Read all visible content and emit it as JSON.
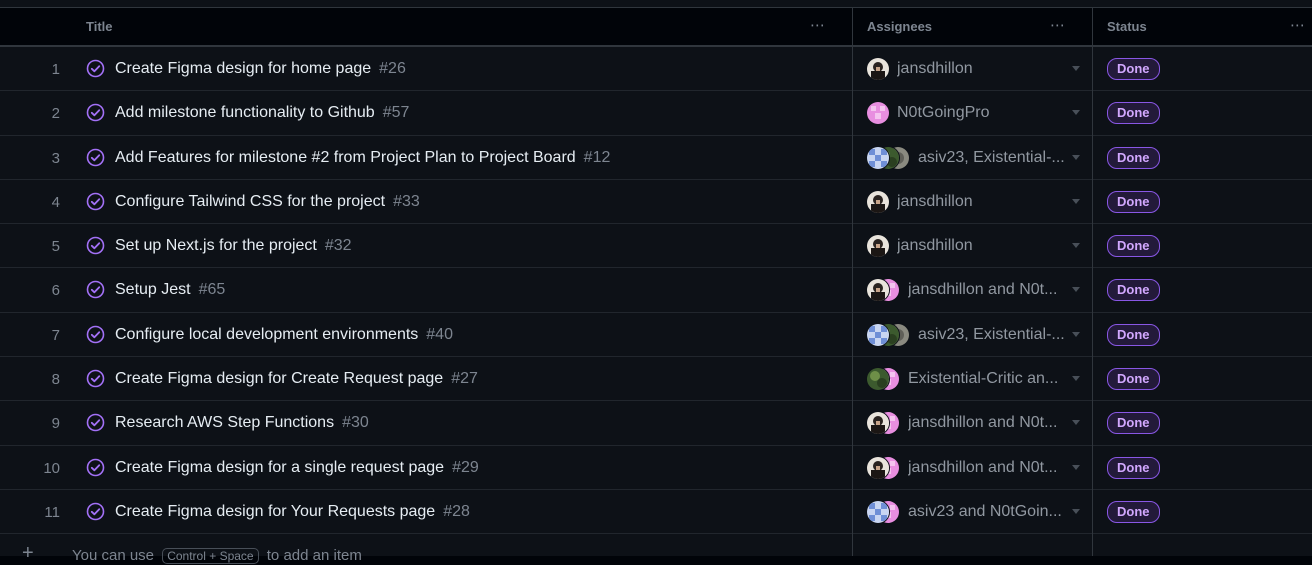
{
  "header": {
    "title_label": "Title",
    "assignees_label": "Assignees",
    "status_label": "Status",
    "more_icon": "⋯"
  },
  "rows": [
    {
      "n": "1",
      "title": "Create Figma design for home page",
      "num": "#26",
      "assignees": "jansdhillon",
      "status": "Done",
      "avatars": [
        "jans"
      ]
    },
    {
      "n": "2",
      "title": "Add milestone functionality to Github",
      "num": "#57",
      "assignees": "N0tGoingPro",
      "status": "Done",
      "avatars": [
        "pink"
      ]
    },
    {
      "n": "3",
      "title": "Add Features for milestone #2 from Project Plan to Project Board",
      "num": "#12",
      "assignees": "asiv23, Existential-...",
      "status": "Done",
      "avatars": [
        "blue",
        "green",
        "gray"
      ]
    },
    {
      "n": "4",
      "title": "Configure Tailwind CSS for the project",
      "num": "#33",
      "assignees": "jansdhillon",
      "status": "Done",
      "avatars": [
        "jans"
      ]
    },
    {
      "n": "5",
      "title": "Set up Next.js for the project",
      "num": "#32",
      "assignees": "jansdhillon",
      "status": "Done",
      "avatars": [
        "jans"
      ]
    },
    {
      "n": "6",
      "title": "Setup Jest",
      "num": "#65",
      "assignees": "jansdhillon and N0t...",
      "status": "Done",
      "avatars": [
        "jans",
        "pink"
      ]
    },
    {
      "n": "7",
      "title": "Configure local development environments",
      "num": "#40",
      "assignees": "asiv23, Existential-...",
      "status": "Done",
      "avatars": [
        "blue",
        "green",
        "gray"
      ]
    },
    {
      "n": "8",
      "title": "Create Figma design for Create Request page",
      "num": "#27",
      "assignees": "Existential-Critic an...",
      "status": "Done",
      "avatars": [
        "green",
        "pink"
      ]
    },
    {
      "n": "9",
      "title": "Research AWS Step Functions",
      "num": "#30",
      "assignees": "jansdhillon and N0t...",
      "status": "Done",
      "avatars": [
        "jans",
        "pink"
      ]
    },
    {
      "n": "10",
      "title": "Create Figma design for a single request page",
      "num": "#29",
      "assignees": "jansdhillon and N0t...",
      "status": "Done",
      "avatars": [
        "jans",
        "pink"
      ]
    },
    {
      "n": "11",
      "title": "Create Figma design for Your Requests page",
      "num": "#28",
      "assignees": "asiv23 and N0tGoin...",
      "status": "Done",
      "avatars": [
        "blue",
        "pink"
      ]
    }
  ],
  "footer": {
    "plus": "+",
    "hint_before": "You can use",
    "hint_kbd": "Control + Space",
    "hint_after": "to add an item"
  },
  "colors": {
    "accent_purple": "#a371f7",
    "badge_text": "#d2a8ff",
    "badge_border": "#8957e5"
  },
  "icons": {
    "status": "circle-check-icon",
    "more": "kebab-horizontal-icon",
    "dropdown": "triangle-down-icon",
    "add": "plus-icon"
  }
}
